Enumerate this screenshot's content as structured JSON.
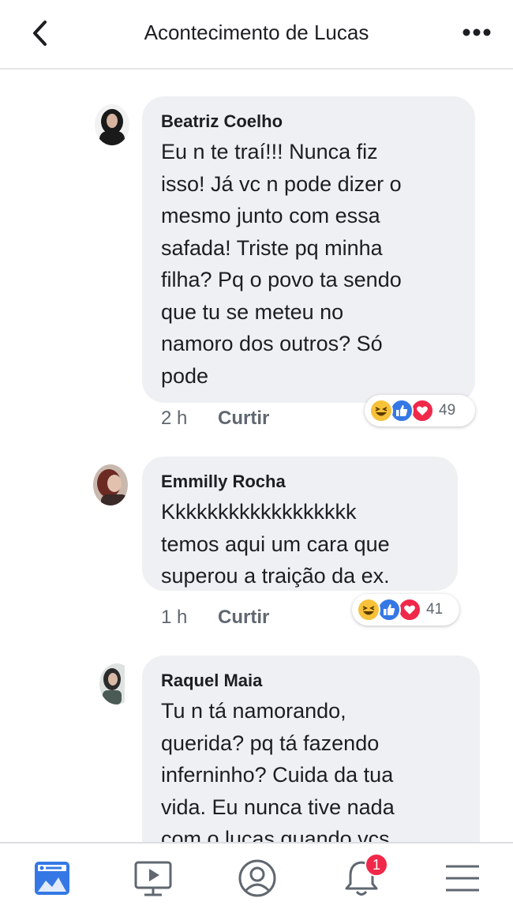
{
  "header": {
    "title": "Acontecimento de Lucas",
    "back_icon": "chevron-left-icon",
    "more_icon": "more-dots-icon"
  },
  "comments": [
    {
      "author": "Beatriz Coelho",
      "text": "Eu n te traí!!! Nunca fiz\nisso! Já vc n pode dizer o\nmesmo junto com essa\nsafada! Triste pq minha\nfilha? Pq o povo ta sendo\nque tu se meteu no\nnamoro dos outros? Só\npode",
      "time": "2 h",
      "like_label": "Curtir",
      "reaction_count": "49"
    },
    {
      "author": "Emmilly Rocha",
      "text": "Kkkkkkkkkkkkkkkkkk\ntemos aqui um cara que\nsuperou a traição da ex.",
      "time": "1 h",
      "like_label": "Curtir",
      "reaction_count": "41"
    },
    {
      "author": "Raquel Maia",
      "text": "Tu n tá namorando,\nquerida? pq tá fazendo\ninferninho?  Cuida da tua\nvida. Eu nunca tive nada\ncom o lucas quando vcs"
    }
  ],
  "tabbar": {
    "notifications_badge": "1",
    "tabs": [
      "news-feed-icon",
      "watch-icon",
      "profile-icon",
      "notifications-icon",
      "menu-icon"
    ]
  },
  "colors": {
    "bubble": "#eff0f3",
    "like_blue": "#3578e5",
    "love_red": "#f0284a",
    "haha_yellow": "#f7c23a",
    "badge_red": "#f02849"
  }
}
